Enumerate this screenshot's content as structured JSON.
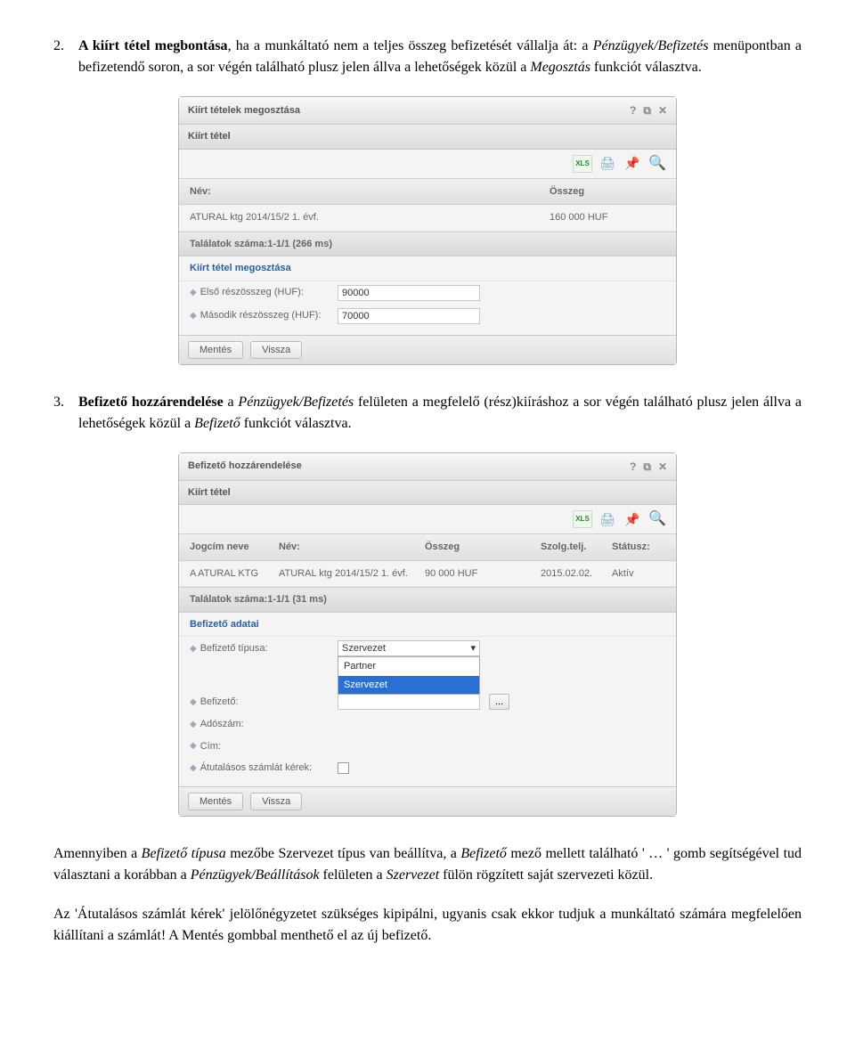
{
  "para1": {
    "num": "2.",
    "bold": "A kiírt tétel megbontása",
    "rest1": ", ha a munkáltató nem a teljes összeg befizetését vállalja át: a ",
    "ital1": "Pénzügyek/Befizetés",
    "rest2": " menüpontban a befizetendő soron, a sor végén található plusz jelen állva a lehetőségek közül a ",
    "ital2": "Megosztás",
    "rest3": " funkciót választva."
  },
  "dlg1": {
    "title": "Kiírt tételek megosztása",
    "sub": "Kiírt tétel",
    "h_nev": "Név:",
    "h_osszeg": "Összeg",
    "d_nev": "ATURAL ktg 2014/15/2 1. évf.",
    "d_osszeg": "160 000 HUF",
    "results": "Találatok száma:1-1/1 (266 ms)",
    "subshare": "Kiírt tétel megosztása",
    "l_elso": "Első részösszeg (HUF):",
    "v_elso": "90000",
    "l_masodik": "Második részösszeg (HUF):",
    "v_masodik": "70000",
    "btn_save": "Mentés",
    "btn_back": "Vissza"
  },
  "para2": {
    "num": "3.",
    "bold": "Befizető hozzárendelése ",
    "rest1": "a ",
    "ital1": "Pénzügyek/Befizetés",
    "rest2": " felületen a megfelelő (rész)kiíráshoz a sor végén található plusz jelen állva a lehetőségek közül a ",
    "ital2": "Befizető",
    "rest3": " funkciót választva."
  },
  "dlg2": {
    "title": "Befizető hozzárendelése",
    "sub": "Kiírt tétel",
    "h_jog": "Jogcím neve",
    "h_nev": "Név:",
    "h_osszeg": "Összeg",
    "h_szt": "Szolg.telj.",
    "h_st": "Státusz:",
    "d_jog": "A ATURAL KTG",
    "d_nev": "ATURAL ktg 2014/15/2 1. évf.",
    "d_osszeg": "90 000 HUF",
    "d_szt": "2015.02.02.",
    "d_st": "Aktív",
    "results": "Találatok száma:1-1/1 (31 ms)",
    "subad": "Befizető adatai",
    "l_tip": "Befizető típusa:",
    "sel_shown": "Szervezet",
    "opt1": "Partner",
    "opt2": "Szervezet",
    "l_bef": "Befizető:",
    "l_ado": "Adószám:",
    "l_cim": "Cím:",
    "l_atut": "Átutalásos számlát kérek:",
    "btn_save": "Mentés",
    "btn_back": "Vissza",
    "threedots": "..."
  },
  "para3": {
    "t1": "Amennyiben a ",
    "i1": "Befizető típusa",
    "t2": " mezőbe Szervezet típus van beállítva, a ",
    "i2": "Befizető",
    "t3": " mező mellett található ' … ' gomb segítségével tud választani a korábban a ",
    "i3": "Pénzügyek/Beállítások",
    "t4": " felületen a ",
    "i4": "Szervezet",
    "t5": " fülön rögzített saját szervezeti közül."
  },
  "para4": {
    "t1": "Az 'Átutalásos számlát kérek' jelölőnégyzetet szükséges kipipálni, ugyanis csak ekkor tudjuk a munkáltató számára megfelelően kiállítani a számlát! A Mentés gombbal menthető el az új befizető."
  }
}
